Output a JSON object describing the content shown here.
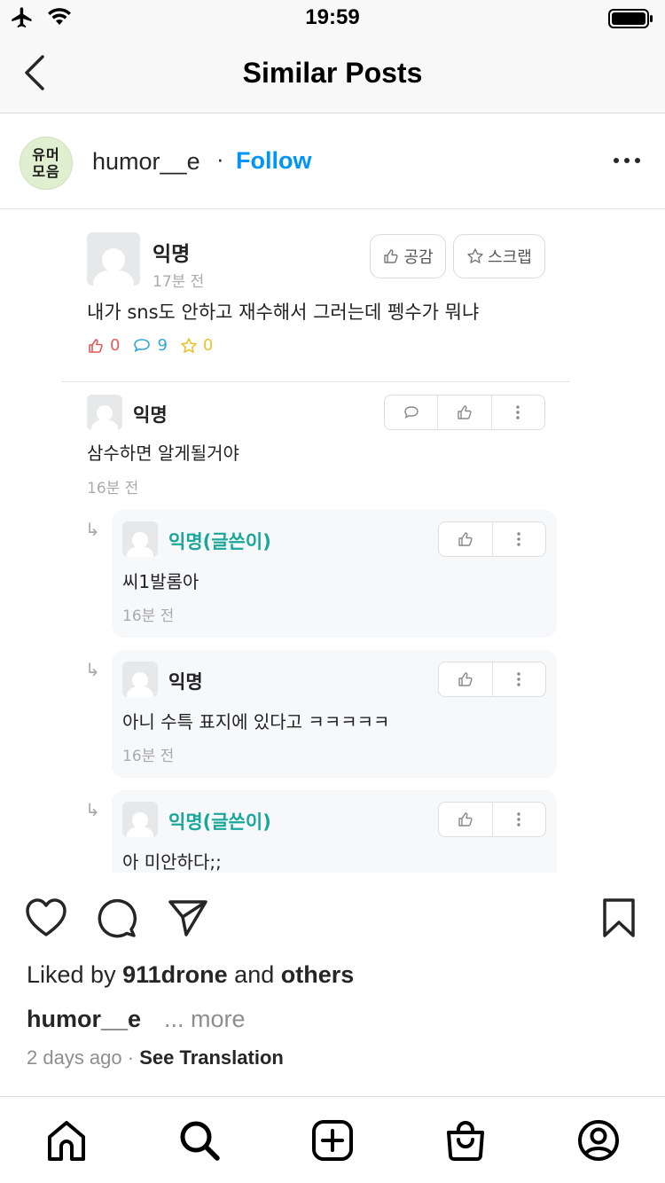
{
  "status_bar": {
    "time": "19:59",
    "icons": [
      "airplane-icon",
      "wifi-icon",
      "battery-icon"
    ]
  },
  "header": {
    "title": "Similar Posts",
    "back_icon": "chevron-left-icon"
  },
  "post": {
    "avatar_text": [
      "유머",
      "모음"
    ],
    "username": "humor__e",
    "separator": "·",
    "follow_label": "Follow",
    "more_icon": "more-horizontal-icon"
  },
  "image": {
    "main": {
      "name": "익명",
      "time": "17분 전",
      "empathy_label": "공감",
      "scrap_label": "스크랩",
      "text": "내가 sns도 안하고 재수해서 그러는데 펭수가 뭐냐",
      "likes": "0",
      "comments": "9",
      "scraps": "0"
    },
    "comment": {
      "name": "익명",
      "text": "삼수하면 알게될거야",
      "time": "16분 전"
    },
    "replies": [
      {
        "name": "익명(글쓴이)",
        "text": "씨1발롬아",
        "time": "16분 전",
        "is_author": true
      },
      {
        "name": "익명",
        "text": "아니 수특 표지에 있다고 ㅋㅋㅋㅋㅋ",
        "time": "16분 전",
        "is_author": false
      },
      {
        "name": "익명(글쓴이)",
        "text": "아 미안하다;;",
        "time": "",
        "is_author": true
      }
    ]
  },
  "actions": {
    "icons": [
      "heart-icon",
      "comment-icon",
      "share-icon",
      "bookmark-icon"
    ]
  },
  "likes": {
    "prefix": "Liked by",
    "user": "911drone",
    "conj": "and",
    "others": "others"
  },
  "caption": {
    "username": "humor__e",
    "more": "... more"
  },
  "meta": {
    "time_ago": "2 days ago",
    "sep": "·",
    "translate": "See Translation"
  },
  "colors": {
    "accent": "#0095f6",
    "author_name": "#1aa79a",
    "like_red": "#e05a5a",
    "comment_blue": "#2ea6d8",
    "scrap_yellow": "#e8c230"
  },
  "tabbar": {
    "icons": [
      "home-icon",
      "search-icon",
      "new-post-icon",
      "shop-icon",
      "profile-icon"
    ]
  }
}
